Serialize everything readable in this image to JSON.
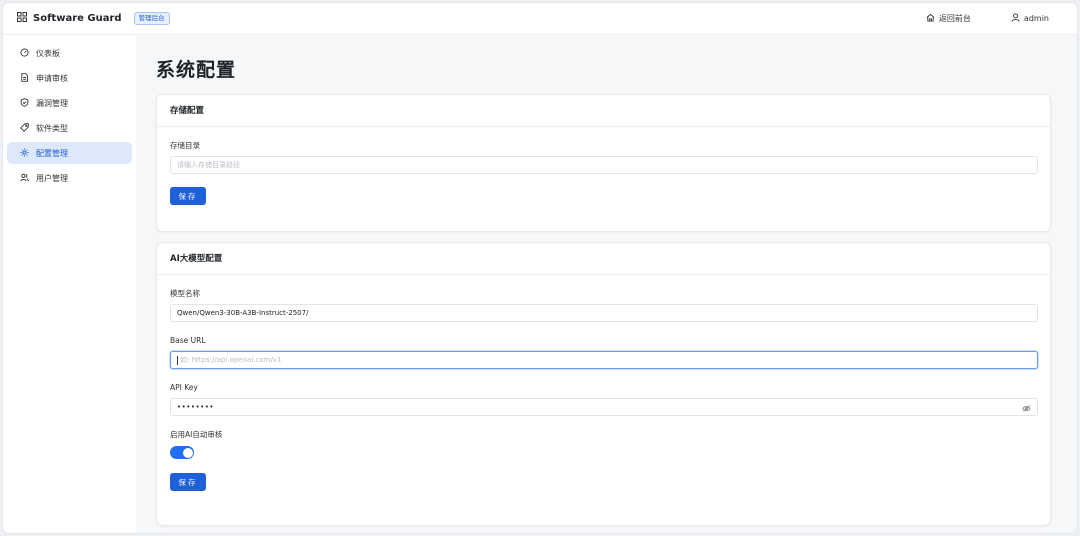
{
  "header": {
    "brand": "Software Guard",
    "badge": "管理后台",
    "back_link": "返回前台",
    "user": "admin"
  },
  "sidebar": {
    "items": [
      {
        "label": "仪表板",
        "icon": "gauge-icon"
      },
      {
        "label": "申请审核",
        "icon": "document-icon"
      },
      {
        "label": "漏洞管理",
        "icon": "shield-check-icon"
      },
      {
        "label": "软件类型",
        "icon": "tag-icon"
      },
      {
        "label": "配置管理",
        "icon": "gear-icon"
      },
      {
        "label": "用户管理",
        "icon": "users-icon"
      }
    ],
    "active_index": 4
  },
  "main": {
    "title": "系统配置",
    "storage": {
      "heading": "存储配置",
      "dir_label": "存储目录",
      "dir_placeholder": "请输入存储目录路径",
      "dir_value": "",
      "save_label": "保存"
    },
    "ai": {
      "heading": "AI大模型配置",
      "model_label": "模型名称",
      "model_value": "Qwen/Qwen3-30B-A3B-Instruct-2507/",
      "url_label": "Base URL",
      "url_placeholder": "如: https://api.openai.com/v1",
      "url_value": "",
      "key_label": "API Key",
      "key_value": "••••••••",
      "auto_review_label": "启用AI自动审核",
      "auto_review_enabled": true,
      "save_label": "保存"
    }
  },
  "colors": {
    "primary": "#1f5fd8",
    "active_bg": "#dde9fb",
    "page_bg": "#f6f7f9"
  }
}
